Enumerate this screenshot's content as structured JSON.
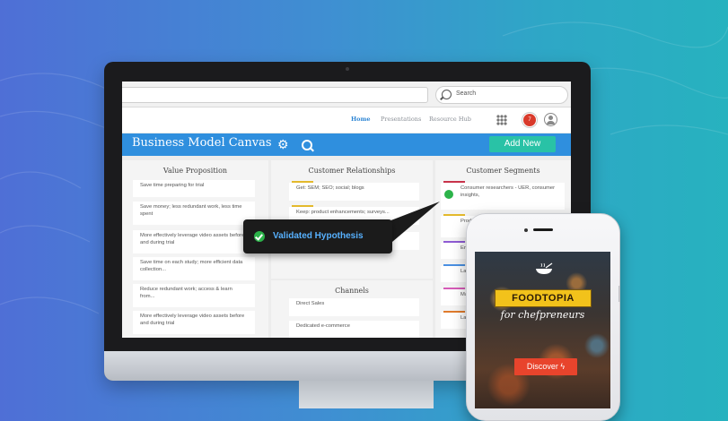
{
  "search": {
    "label": "Search"
  },
  "nav": {
    "items": [
      "Home",
      "Presentations",
      "Resource Hub"
    ],
    "active": "Home",
    "notification_count": "7"
  },
  "header": {
    "title": "Business Model Canvas",
    "add_button": "Add New"
  },
  "columns": {
    "value_proposition": {
      "title": "Value Proposition",
      "cards": [
        "Save time preparing for trial",
        "Save money; less redundant work, less time spent",
        "More effectively leverage video assets before and during trial",
        "Save time on each study; more efficient data collection...",
        "Reduce redundant work; access & learn from...",
        "More effectively leverage video assets before and during trial"
      ]
    },
    "customer_relationships": {
      "title": "Customer Relationships",
      "cards": [
        "Get: SEM; SEO; social; blogs",
        "Keep: product enhancements; surveys..."
      ]
    },
    "channels": {
      "title": "Channels",
      "cards": [
        "Direct Sales",
        "Dedicated e-commerce"
      ]
    },
    "customer_segments": {
      "title": "Customer Segments",
      "cards": [
        "Consumer researchers - UER, consumer insights,",
        "Produ manag",
        "Entre",
        "Law f",
        "Mark",
        "Later"
      ],
      "bar_colors": [
        "#c8334a",
        "#e3b92c",
        "#8e5bd3",
        "#4a90e2",
        "#d65bb8",
        "#e07b2c"
      ]
    }
  },
  "tooltip": {
    "text": "Validated Hypothesis"
  },
  "phone": {
    "brand": "FOODTOPIA",
    "tagline": "for chefpreneurs",
    "cta": "Discover"
  },
  "colors": {
    "accent_blue": "#2f8fde",
    "add_green": "#29c2a6",
    "validated_green": "#2cb34a",
    "tooltip_text": "#57b1ff"
  }
}
